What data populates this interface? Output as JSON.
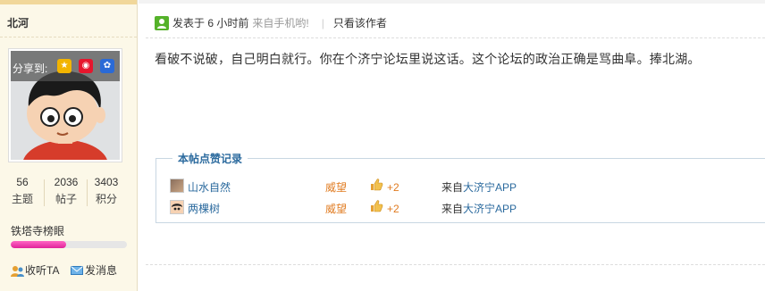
{
  "sidebar": {
    "username": "北河",
    "share_label": "分享到:",
    "share_icons": [
      "qzone-icon",
      "weibo-icon",
      "baidu-icon"
    ],
    "stats": [
      {
        "value": "56",
        "label": "主题"
      },
      {
        "value": "2036",
        "label": "帖子"
      },
      {
        "value": "3403",
        "label": "积分"
      }
    ],
    "rank_name": "铁塔寺榜眼",
    "rank_progress": 0.48,
    "actions": {
      "follow": "收听TA",
      "message": "发消息"
    }
  },
  "post": {
    "posted_at": "发表于 6 小时前",
    "from_mobile": "来自手机哟!",
    "separator": "|",
    "only_author": "只看该作者",
    "content": "看破不说破，自己明白就行。你在个济宁论坛里说这话。这个论坛的政治正确是骂曲阜。捧北湖。"
  },
  "rating": {
    "title": "本帖点赞记录",
    "rows": [
      {
        "user": "山水自然",
        "kind": "威望",
        "score": "+2",
        "source_prefix": "来自",
        "source_app": "大济宁APP"
      },
      {
        "user": "两棵树",
        "kind": "威望",
        "score": "+2",
        "source_prefix": "来自",
        "source_app": "大济宁APP"
      }
    ]
  },
  "colors": {
    "sidebar_bg": "#fcf8e8",
    "link_blue": "#2b6a9e",
    "orange": "#e07b20",
    "rank_pink": "#e0239a"
  }
}
